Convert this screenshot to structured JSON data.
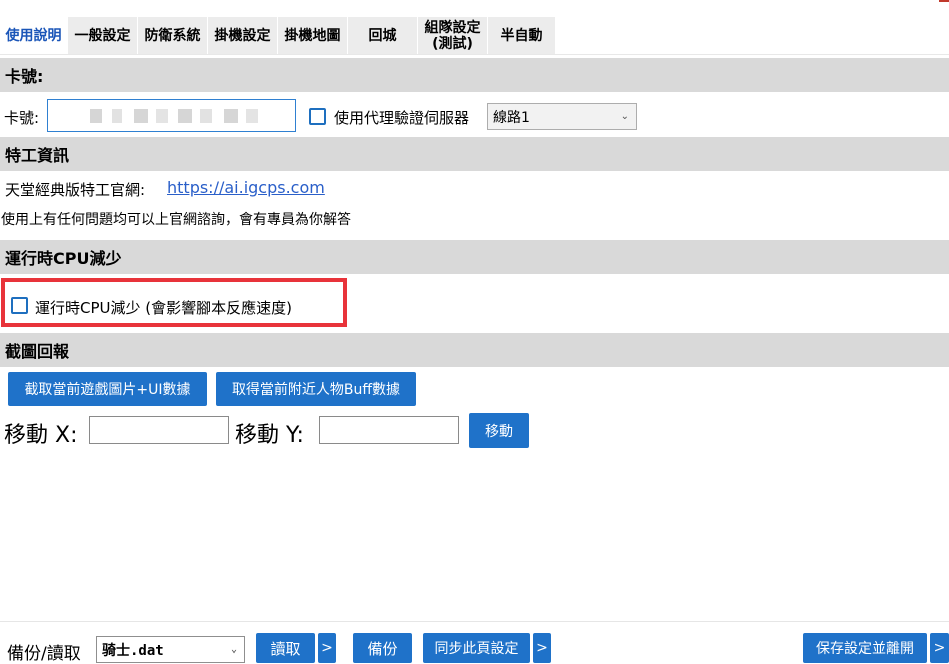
{
  "tabs": [
    {
      "label": "使用說明",
      "active": true
    },
    {
      "label": "一般設定"
    },
    {
      "label": "防衛系統"
    },
    {
      "label": "掛機設定"
    },
    {
      "label": "掛機地圖"
    },
    {
      "label": "回城"
    },
    {
      "label": "組隊設定\n(測試)"
    },
    {
      "label": "半自動"
    }
  ],
  "card_section": {
    "title": "卡號:",
    "card_label": "卡號:",
    "proxy_label": "使用代理驗證伺服器",
    "proxy_checked": false,
    "route_value": "線路1"
  },
  "agent_section": {
    "title": "特工資訊",
    "site_label": "天堂經典版特工官網:",
    "site_link": "https://ai.igcps.com",
    "note": "使用上有任何問題均可以上官網諮詢，會有專員為你解答"
  },
  "cpu_section": {
    "title": "運行時CPU減少",
    "checkbox_label": "運行時CPU減少 (會影響腳本反應速度)",
    "checked": false
  },
  "screenshot_section": {
    "title": "截圖回報",
    "capture_button": "截取當前遊戲圖片+UI數據",
    "buff_button": "取得當前附近人物Buff數據",
    "move_x_label": "移動 X:",
    "move_y_label": "移動 Y:",
    "move_x_value": "",
    "move_y_value": "",
    "move_button": "移動"
  },
  "bottom_bar": {
    "backup_label": "備份/讀取",
    "file_value": "骑士.dat",
    "read_button": "讀取",
    "more_glyph": ">",
    "backup_button": "備份",
    "sync_button": "同步此頁設定",
    "save_exit_button": "保存設定並離開"
  },
  "colors": {
    "accent": "#1f72c9",
    "active_tab_text": "#1a55b8",
    "section_bg": "#d9d9d9",
    "highlight_border": "#e8333a",
    "link": "#2a5fc9"
  }
}
